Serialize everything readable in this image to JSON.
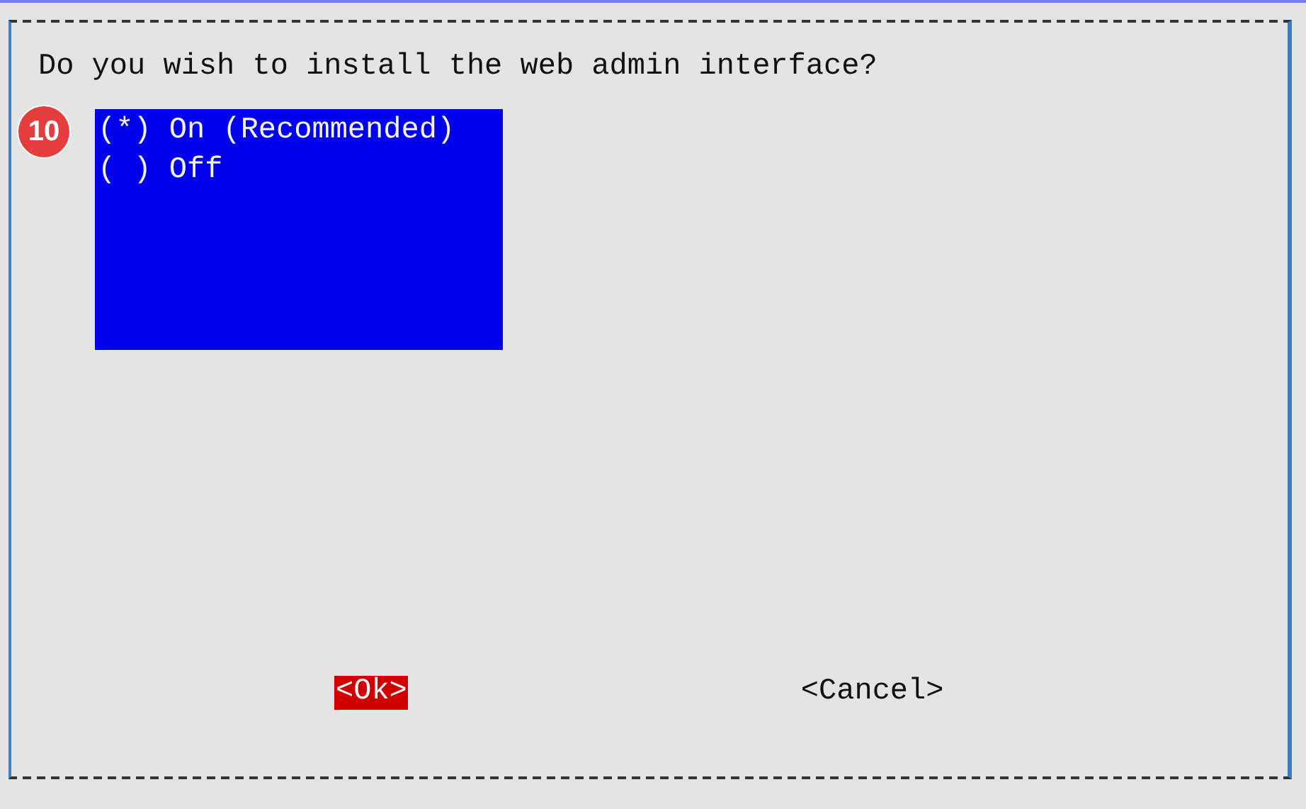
{
  "dialog": {
    "question": "Do you wish to install the web admin interface?",
    "options": [
      {
        "label": "(*) On (Recommended)"
      },
      {
        "label": "( ) Off"
      }
    ],
    "buttons": [
      {
        "label": "<Ok>",
        "focused": true
      },
      {
        "label": "<Cancel>",
        "focused": false
      }
    ]
  },
  "step_badge": "10"
}
